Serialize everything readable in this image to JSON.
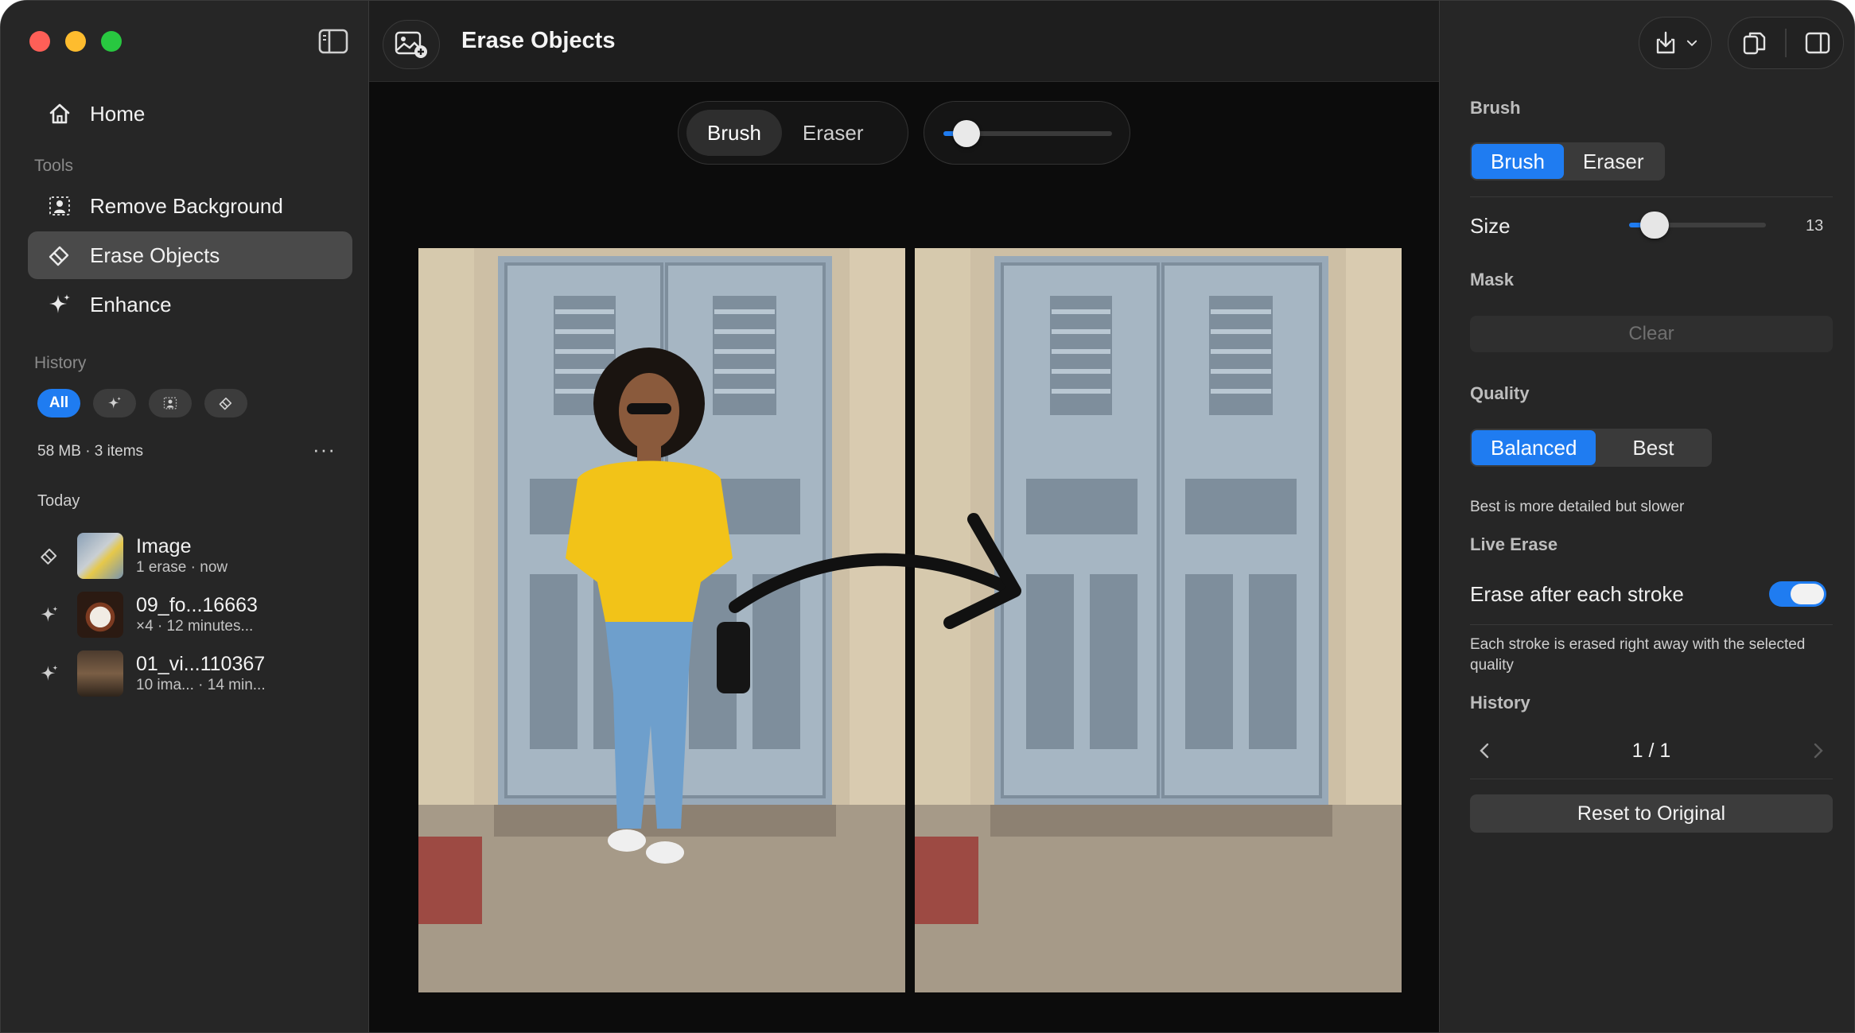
{
  "window": {
    "title": "Erase Objects"
  },
  "sidebar": {
    "home_label": "Home",
    "tools_label": "Tools",
    "tools": [
      {
        "label": "Remove Background",
        "icon": "person-cutout-icon"
      },
      {
        "label": "Erase Objects",
        "icon": "eraser-icon",
        "active": true
      },
      {
        "label": "Enhance",
        "icon": "sparkles-icon"
      }
    ],
    "history_label": "History",
    "filters": [
      {
        "label": "All",
        "active": true
      },
      {
        "icon": "sparkles-icon"
      },
      {
        "icon": "person-cutout-icon"
      },
      {
        "icon": "eraser-icon"
      }
    ],
    "storage": "58 MB · 3 items",
    "more_label": "···",
    "today_label": "Today",
    "items": [
      {
        "title": "Image",
        "sub": "1 erase  ·  now",
        "icon": "eraser-icon"
      },
      {
        "title": "09_fo...16663",
        "sub": "×4  ·  12 minutes...",
        "icon": "sparkles-icon"
      },
      {
        "title": "01_vi...110367",
        "sub": "10 ima...  ·  14 min...",
        "icon": "sparkles-icon"
      }
    ]
  },
  "canvas": {
    "tool_options": [
      "Brush",
      "Eraser"
    ],
    "active_tool": "Brush",
    "brush_size_fraction": 0.07
  },
  "panel": {
    "brush_label": "Brush",
    "brush_options": [
      "Brush",
      "Eraser"
    ],
    "size_label": "Size",
    "size_value": "13",
    "size_fraction": 0.1,
    "mask_label": "Mask",
    "clear_label": "Clear",
    "quality_label": "Quality",
    "quality_options": [
      "Balanced",
      "Best"
    ],
    "quality_hint": "Best is more detailed but slower",
    "live_erase_label": "Live Erase",
    "erase_after_label": "Erase after each stroke",
    "erase_after_on": true,
    "erase_after_hint": "Each stroke is erased right away with the selected quality",
    "history_label": "History",
    "history_count": "1 / 1",
    "reset_label": "Reset to Original"
  },
  "colors": {
    "accent": "#1f7cf1",
    "window_bg": "#101010",
    "sidebar_bg": "#262626"
  }
}
